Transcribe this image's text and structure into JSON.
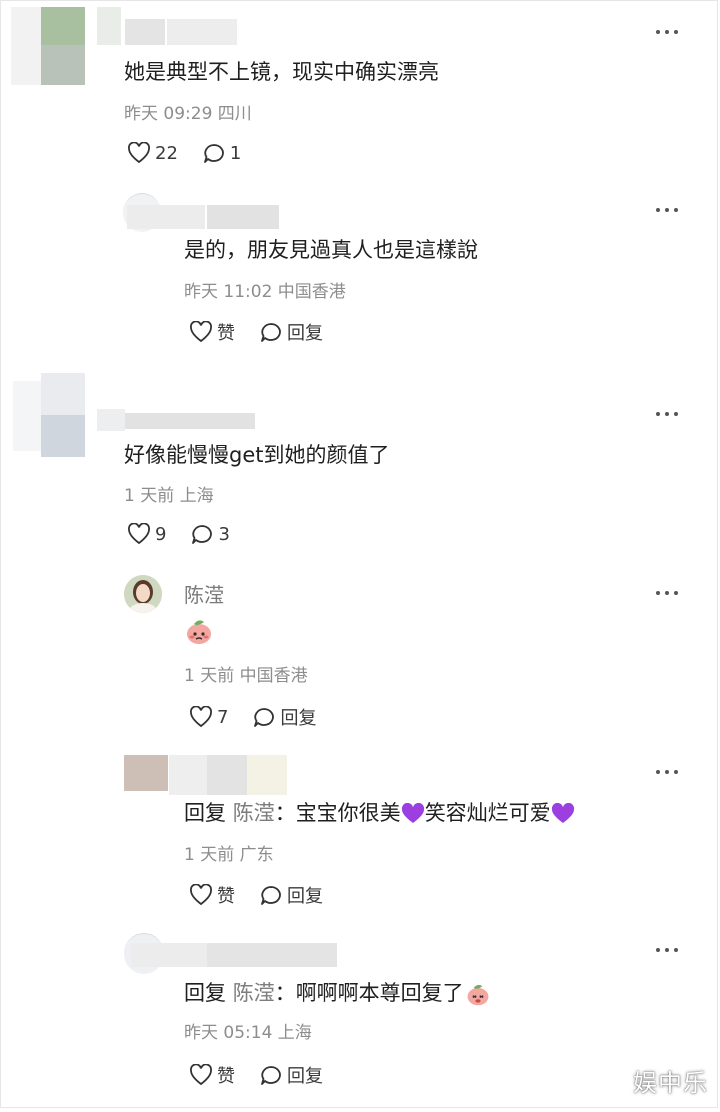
{
  "comments": [
    {
      "content": "她是典型不上镜，现实中确实漂亮",
      "meta": "昨天 09:29 四川",
      "likes": "22",
      "replies": "1"
    },
    {
      "content": "是的，朋友見過真人也是這樣說",
      "meta": "昨天 11:02 中国香港",
      "like_label": "赞",
      "reply_label": "回复"
    },
    {
      "content": "好像能慢慢get到她的颜值了",
      "meta": "1 天前 上海",
      "likes": "9",
      "replies": "3"
    },
    {
      "name": "陈滢",
      "meta": "1 天前 中国香港",
      "likes": "7",
      "reply_label": "回复"
    },
    {
      "reply_prefix": "回复",
      "mention": "陈滢",
      "colon": "：",
      "text1": "宝宝你很美",
      "text2": "笑容灿烂可爱",
      "meta": "1 天前 广东",
      "like_label": "赞",
      "reply_label": "回复"
    },
    {
      "reply_prefix": "回复",
      "mention": "陈滢",
      "colon": "：",
      "text1": "啊啊啊本尊回复了",
      "meta": "昨天 05:14 上海",
      "like_label": "赞",
      "reply_label": "回复"
    }
  ],
  "watermark": "娱中乐",
  "icons": [
    "heart-outline-icon",
    "comment-bubble-icon",
    "more-dots-icon",
    "purple-heart-emoji",
    "peach-emoji"
  ]
}
